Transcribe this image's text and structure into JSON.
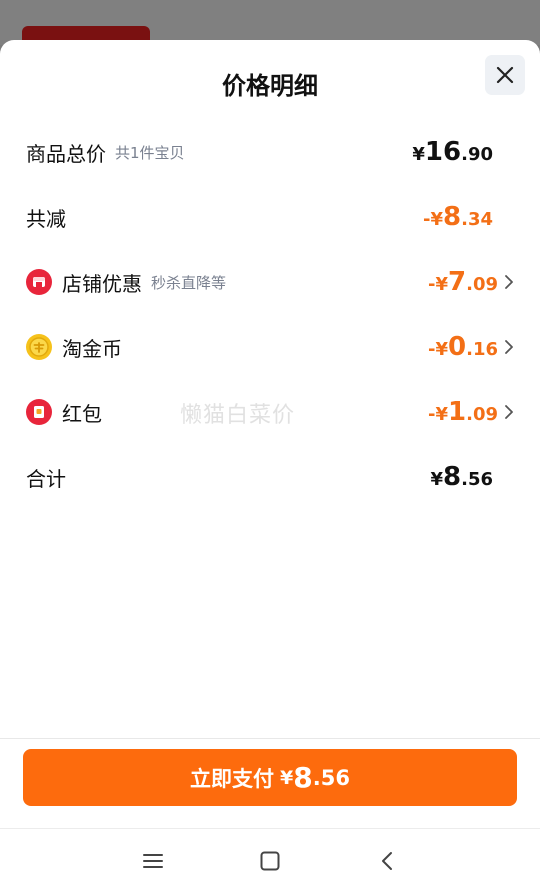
{
  "sheet": {
    "title": "价格明细"
  },
  "rows": [
    {
      "label": "商品总价",
      "sub": "共1件宝贝",
      "currency": "¥",
      "int": "16",
      "dec": ".90"
    },
    {
      "label": "共减",
      "currency": "-¥",
      "int": "8",
      "dec": ".34"
    },
    {
      "label": "店铺优惠",
      "sub": "秒杀直降等",
      "currency": "-¥",
      "int": "7",
      "dec": ".09"
    },
    {
      "label": "淘金币",
      "currency": "-¥",
      "int": "0",
      "dec": ".16"
    },
    {
      "label": "红包",
      "currency": "-¥",
      "int": "1",
      "dec": ".09"
    },
    {
      "label": "合计",
      "currency": "¥",
      "int": "8",
      "dec": ".56"
    }
  ],
  "watermark": "懒猫白菜价",
  "pay": {
    "label": "立即支付",
    "currency": "¥",
    "int": "8",
    "dec": ".56"
  },
  "colors": {
    "accent": "#fd6b0d",
    "discount": "#f36f16"
  },
  "icons": {
    "shop": "shop-discount-icon",
    "coin": "taojinbi-coin-icon",
    "redpacket": "red-packet-icon"
  }
}
